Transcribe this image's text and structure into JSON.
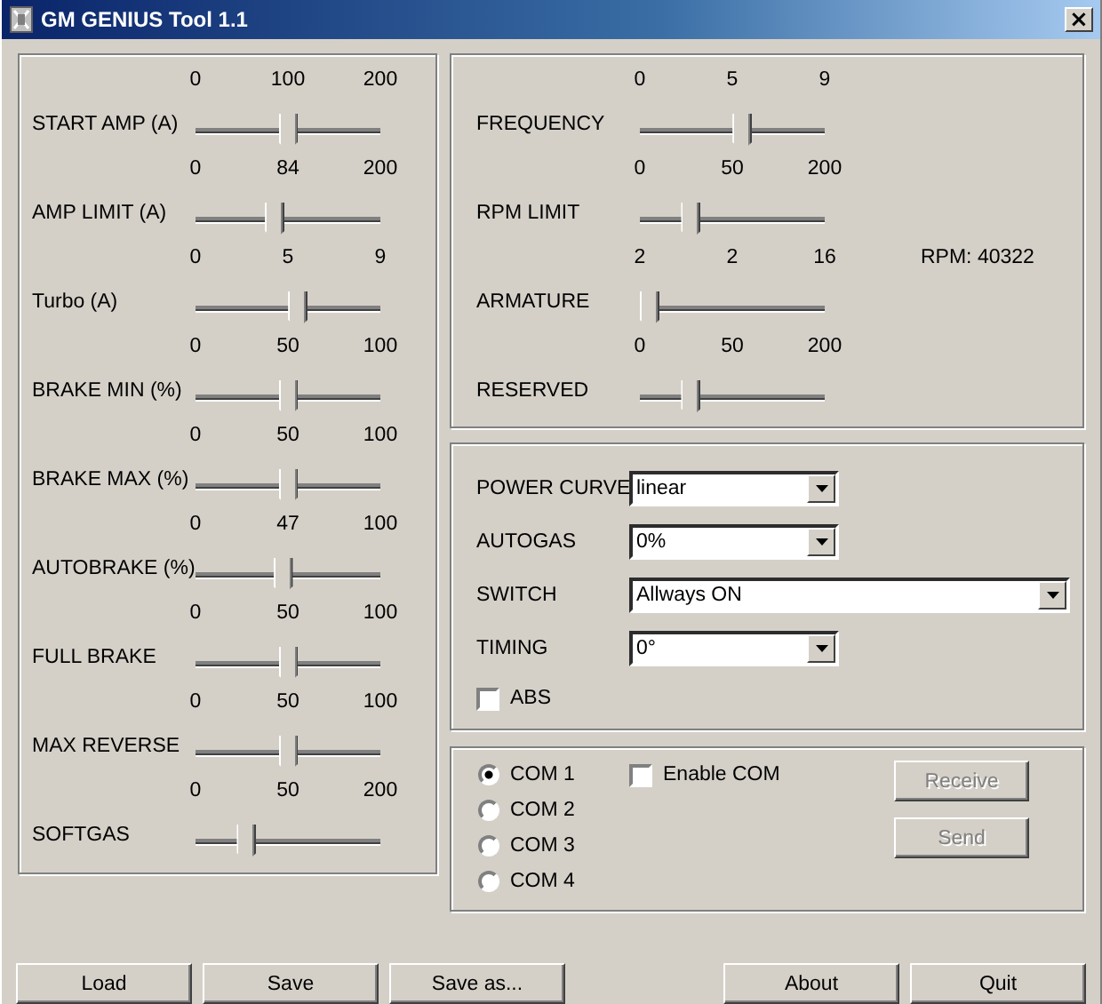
{
  "window": {
    "title": "GM GENIUS Tool 1.1",
    "close": "×"
  },
  "left_sliders": [
    {
      "label": "START AMP (A)",
      "min": "0",
      "value": "100",
      "max": "200",
      "level": 0.5
    },
    {
      "label": "AMP LIMIT (A)",
      "min": "0",
      "value": "84",
      "max": "200",
      "level": 0.42
    },
    {
      "label": "Turbo (A)",
      "min": "0",
      "value": "5",
      "max": "9",
      "level": 0.56
    },
    {
      "label": "BRAKE MIN (%)",
      "min": "0",
      "value": "50",
      "max": "100",
      "level": 0.5
    },
    {
      "label": "BRAKE MAX (%)",
      "min": "0",
      "value": "50",
      "max": "100",
      "level": 0.5
    },
    {
      "label": "AUTOBRAKE (%)",
      "min": "0",
      "value": "47",
      "max": "100",
      "level": 0.47
    },
    {
      "label": "FULL BRAKE",
      "min": "0",
      "value": "50",
      "max": "100",
      "level": 0.5
    },
    {
      "label": "MAX REVERSE",
      "min": "0",
      "value": "50",
      "max": "100",
      "level": 0.5
    },
    {
      "label": "SOFTGAS",
      "min": "0",
      "value": "50",
      "max": "200",
      "level": 0.25
    }
  ],
  "right_sliders": [
    {
      "label": "FREQUENCY",
      "min": "0",
      "value": "5",
      "max": "9",
      "level": 0.56
    },
    {
      "label": "RPM LIMIT",
      "min": "0",
      "value": "50",
      "max": "200",
      "level": 0.25
    },
    {
      "label": "ARMATURE",
      "min": "2",
      "value": "2",
      "max": "16",
      "level": 0,
      "reading": "RPM: 40322"
    },
    {
      "label": "RESERVED",
      "min": "0",
      "value": "50",
      "max": "200",
      "level": 0.25
    }
  ],
  "dropdowns": [
    {
      "label": "POWER CURVE",
      "value": "linear",
      "wide": false
    },
    {
      "label": "AUTOGAS",
      "value": "0%",
      "wide": false
    },
    {
      "label": "SWITCH",
      "value": "Allways ON",
      "wide": true
    },
    {
      "label": "TIMING",
      "value": "0°",
      "wide": false
    }
  ],
  "abs": {
    "label": "ABS",
    "checked": false
  },
  "com_ports": [
    {
      "label": "COM 1",
      "selected": true
    },
    {
      "label": "COM 2",
      "selected": false
    },
    {
      "label": "COM 3",
      "selected": false
    },
    {
      "label": "COM 4",
      "selected": false
    }
  ],
  "enable_com": {
    "label": "Enable COM",
    "checked": false
  },
  "com_buttons": [
    {
      "label": "Receive",
      "disabled": true
    },
    {
      "label": "Send",
      "disabled": true
    }
  ],
  "bottom_buttons_left": [
    {
      "label": "Load"
    },
    {
      "label": "Save"
    },
    {
      "label": "Save as..."
    }
  ],
  "bottom_buttons_right": [
    {
      "label": "About"
    },
    {
      "label": "Quit"
    }
  ]
}
